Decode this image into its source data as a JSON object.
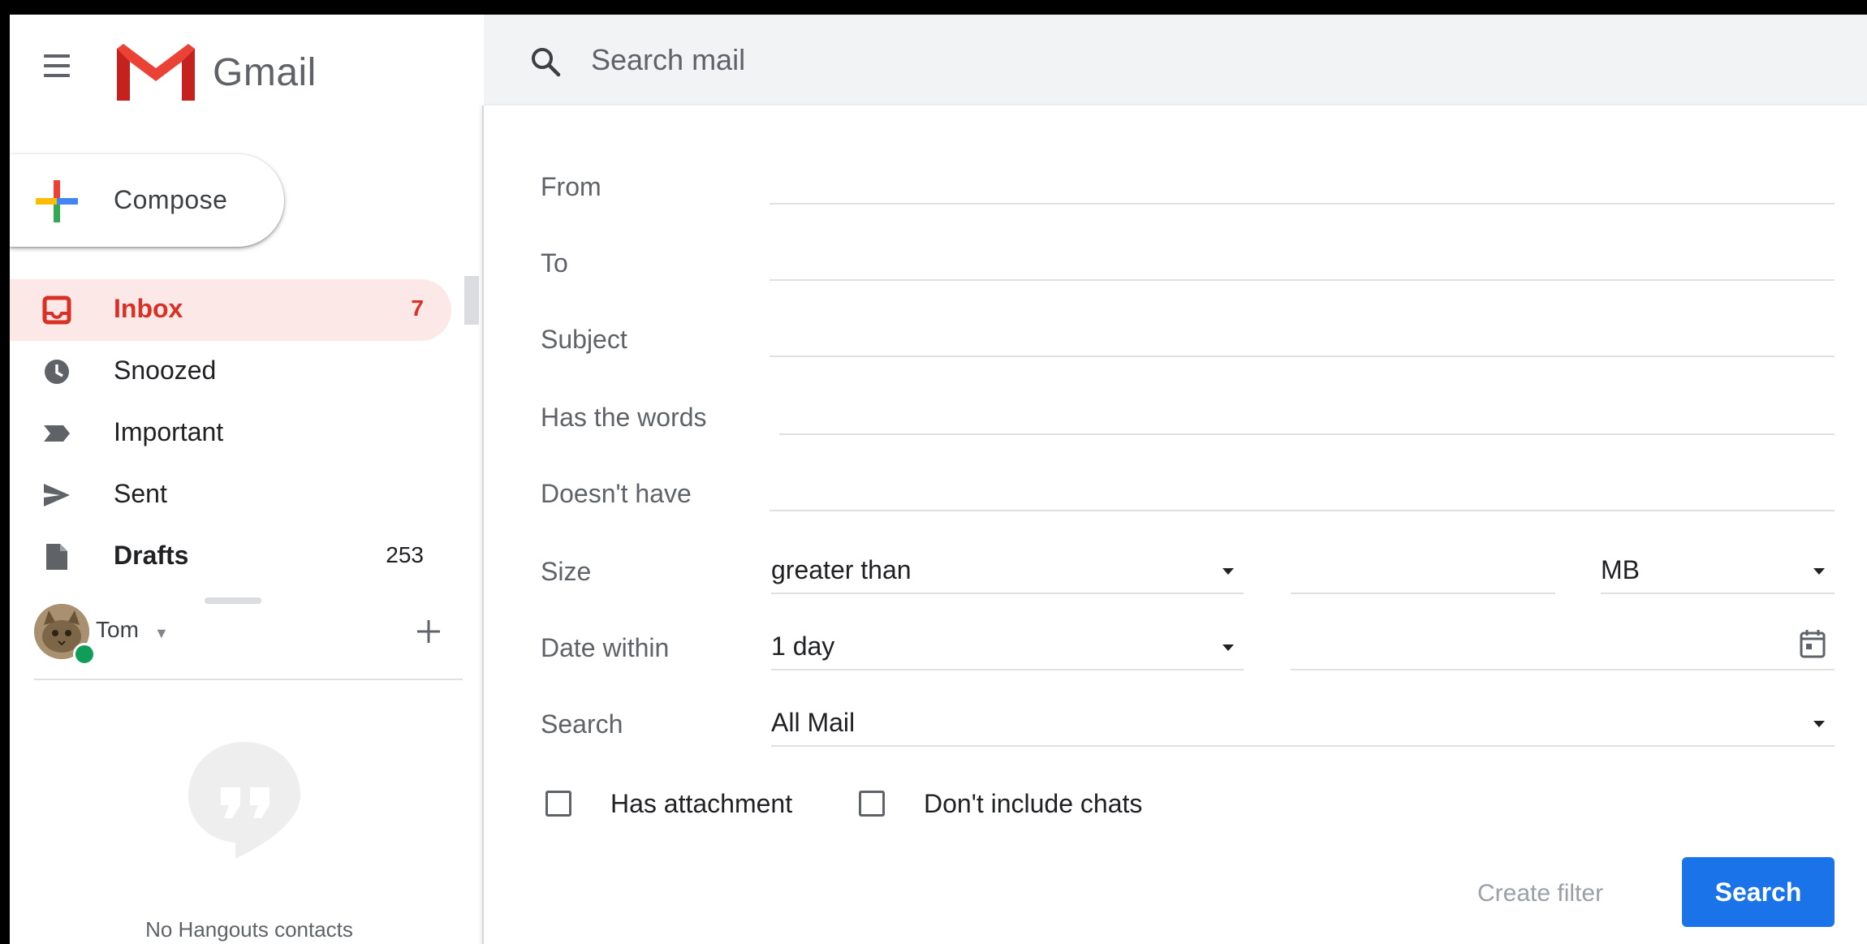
{
  "app": {
    "name": "Gmail"
  },
  "search": {
    "placeholder": "Search mail"
  },
  "compose": {
    "label": "Compose"
  },
  "nav": {
    "items": [
      {
        "label": "Inbox",
        "count": "7",
        "icon": "inbox-icon",
        "active": true
      },
      {
        "label": "Snoozed",
        "count": "",
        "icon": "clock-icon",
        "active": false
      },
      {
        "label": "Important",
        "count": "",
        "icon": "important-icon",
        "active": false
      },
      {
        "label": "Sent",
        "count": "",
        "icon": "send-icon",
        "active": false
      },
      {
        "label": "Drafts",
        "count": "253",
        "icon": "draft-icon",
        "active": false
      }
    ]
  },
  "hangouts": {
    "user": "Tom",
    "status": "online",
    "empty_text": "No Hangouts contacts"
  },
  "advanced_search": {
    "from_label": "From",
    "to_label": "To",
    "subject_label": "Subject",
    "has_words_label": "Has the words",
    "doesnt_have_label": "Doesn't have",
    "size_label": "Size",
    "size_operator": "greater than",
    "size_unit": "MB",
    "date_within_label": "Date within",
    "date_within_value": "1 day",
    "search_in_label": "Search",
    "search_in_value": "All Mail",
    "has_attachment_label": "Has attachment",
    "dont_include_chats_label": "Don't include chats",
    "create_filter_label": "Create filter",
    "search_button_label": "Search"
  },
  "colors": {
    "accent_red": "#d93025",
    "active_bg": "#fce8e6",
    "primary_blue": "#1a73e8",
    "text_secondary": "#5f6368"
  }
}
